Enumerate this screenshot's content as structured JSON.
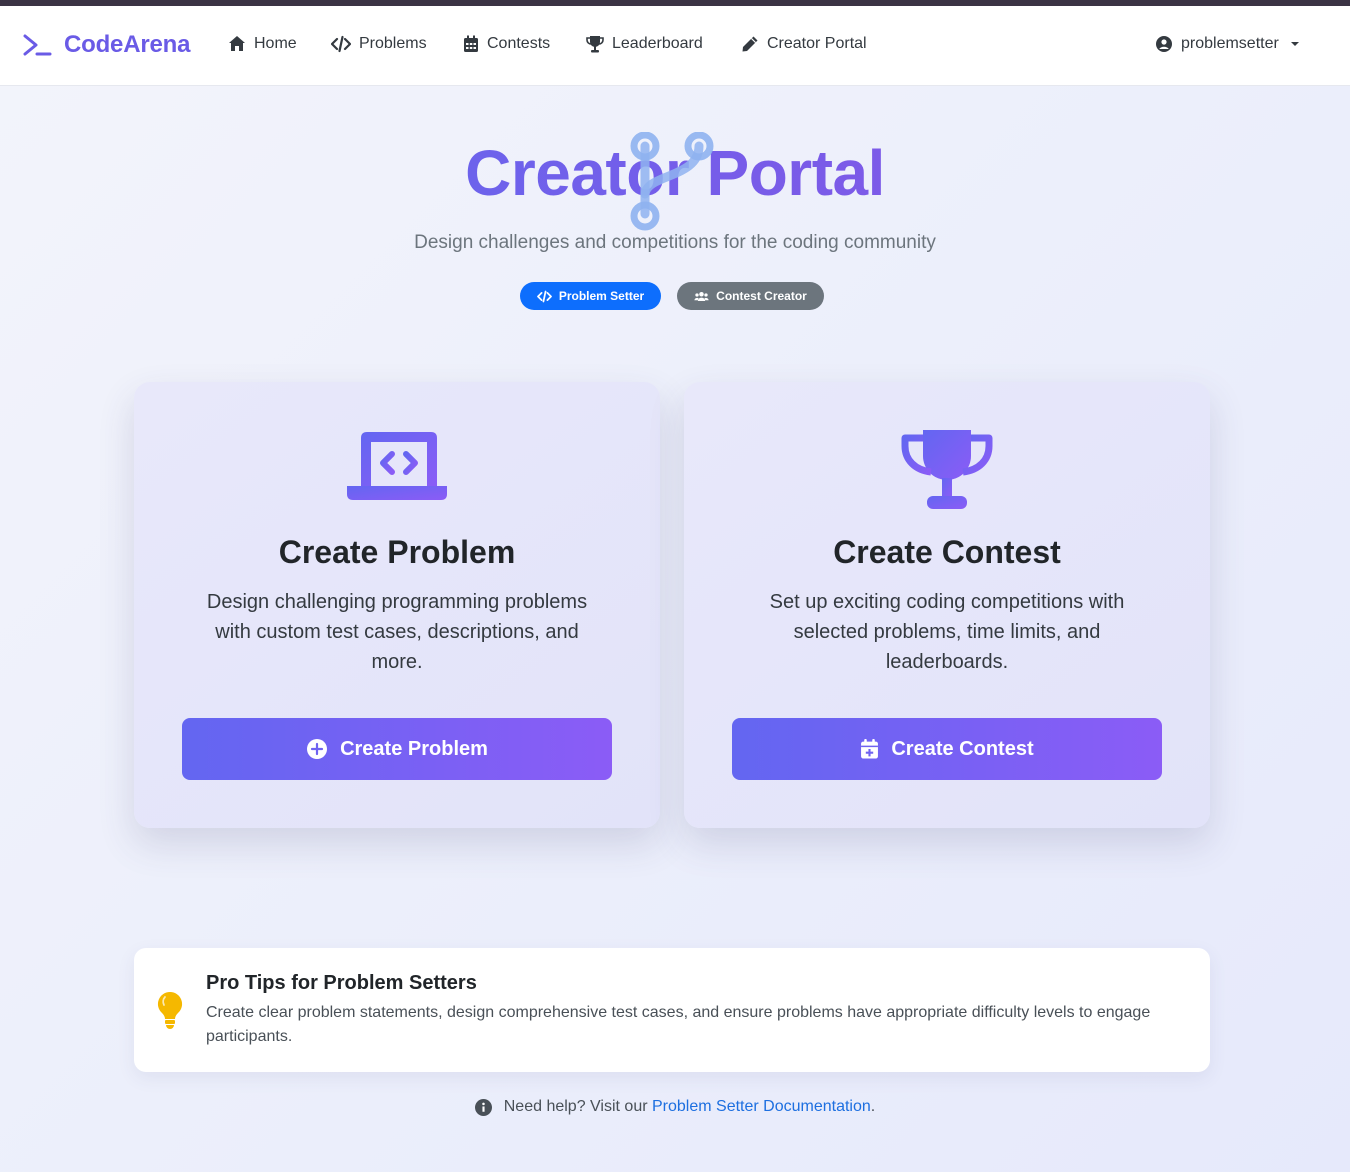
{
  "brand": {
    "name": "CodeArena",
    "icon": "terminal-icon",
    "color": "#6a5be6"
  },
  "nav": {
    "items": [
      {
        "label": "Home",
        "icon": "home-icon"
      },
      {
        "label": "Problems",
        "icon": "code-icon"
      },
      {
        "label": "Contests",
        "icon": "calendar-icon"
      },
      {
        "label": "Leaderboard",
        "icon": "trophy-icon"
      },
      {
        "label": "Creator Portal",
        "icon": "pencil-icon"
      }
    ],
    "user": {
      "name": "problemsetter",
      "icon": "user-circle-icon"
    }
  },
  "hero": {
    "title": "Creator Portal",
    "subtitle": "Design challenges and competitions for the coding community",
    "badges": [
      {
        "label": "Problem Setter",
        "icon": "code-icon",
        "color": "#0d6efd"
      },
      {
        "label": "Contest Creator",
        "icon": "users-icon",
        "color": "#6c757d"
      }
    ]
  },
  "cards": [
    {
      "icon": "laptop-code-icon",
      "title": "Create Problem",
      "description": "Design challenging programming problems with custom test cases, descriptions, and more.",
      "button": {
        "label": "Create Problem",
        "icon": "plus-circle-icon"
      }
    },
    {
      "icon": "trophy-icon",
      "title": "Create Contest",
      "description": "Set up exciting coding competitions with selected problems, time limits, and leaderboards.",
      "button": {
        "label": "Create Contest",
        "icon": "calendar-plus-icon"
      }
    }
  ],
  "tips": {
    "icon": "lightbulb-icon",
    "title": "Pro Tips for Problem Setters",
    "text": "Create clear problem statements, design comprehensive test cases, and ensure problems have appropriate difficulty levels to engage participants."
  },
  "help": {
    "icon": "info-circle-icon",
    "prefix": "Need help? Visit our ",
    "link_text": "Problem Setter Documentation",
    "suffix": "."
  },
  "colors": {
    "accent": "#6366f1",
    "accent_end": "#8b5cf6",
    "link": "#1d6fe0",
    "tip": "#f5b800"
  }
}
